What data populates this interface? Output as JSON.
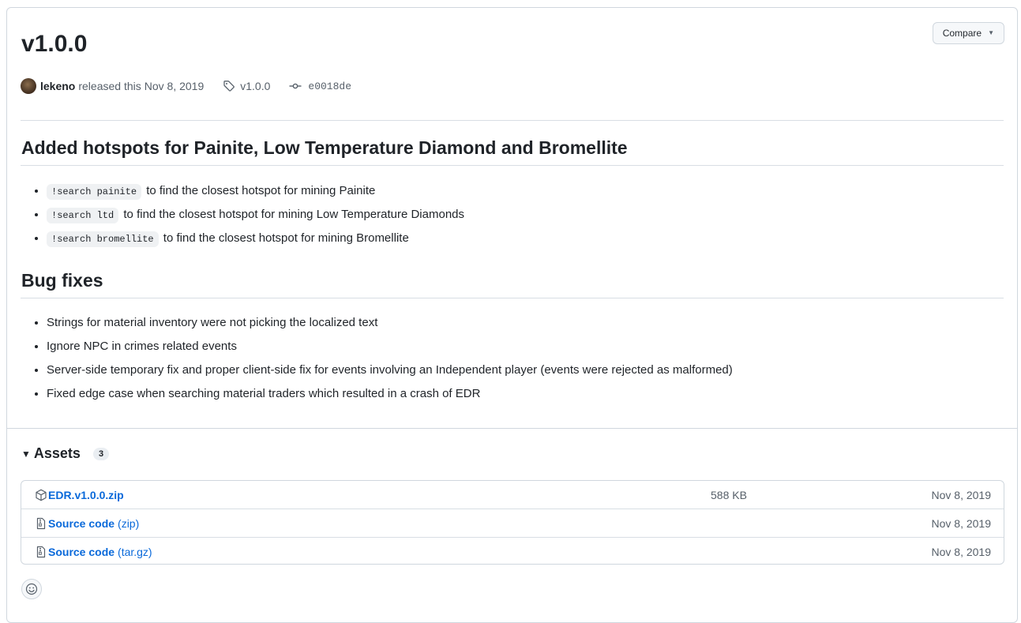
{
  "release": {
    "title": "v1.0.0",
    "author": "lekeno",
    "released_text": "released this",
    "date": "Nov 8, 2019",
    "tag": "v1.0.0",
    "commit": "e0018de",
    "compare_label": "Compare"
  },
  "notes": {
    "section1": {
      "heading": "Added hotspots for Painite, Low Temperature Diamond and Bromellite",
      "items": [
        {
          "code": "!search painite",
          "text": "to find the closest hotspot for mining Painite"
        },
        {
          "code": "!search ltd",
          "text": "to find the closest hotspot for mining Low Temperature Diamonds"
        },
        {
          "code": "!search bromellite",
          "text": "to find the closest hotspot for mining Bromellite"
        }
      ]
    },
    "section2": {
      "heading": "Bug fixes",
      "items": [
        "Strings for material inventory were not picking the localized text",
        "Ignore NPC in crimes related events",
        "Server-side temporary fix and proper client-side fix for events involving an Independent player (events were rejected as malformed)",
        "Fixed edge case when searching material traders which resulted in a crash of EDR"
      ]
    }
  },
  "assets": {
    "label": "Assets",
    "count": "3",
    "rows": [
      {
        "name": "EDR.v1.0.0.zip",
        "suffix": "",
        "size": "588 KB",
        "date": "Nov 8, 2019",
        "icon": "package-icon"
      },
      {
        "name": "Source code",
        "suffix": "(zip)",
        "size": "",
        "date": "Nov 8, 2019",
        "icon": "file-zip-icon"
      },
      {
        "name": "Source code",
        "suffix": "(tar.gz)",
        "size": "",
        "date": "Nov 8, 2019",
        "icon": "file-zip-icon"
      }
    ]
  },
  "colors": {
    "link": "#0969da",
    "border": "#d0d7de",
    "muted": "#57606a"
  }
}
